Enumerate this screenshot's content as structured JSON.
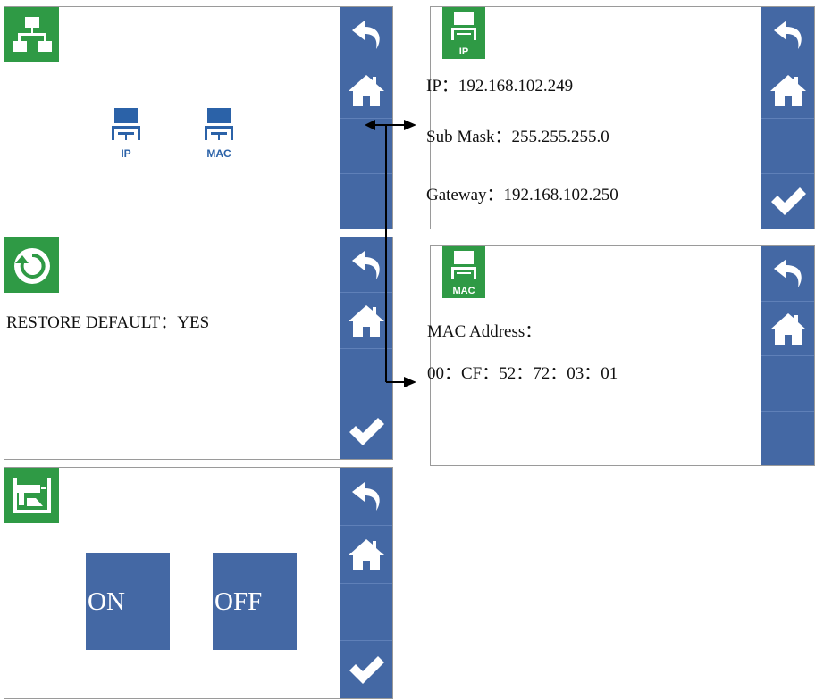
{
  "network_panel": {
    "buttons": [
      {
        "label": "IP"
      },
      {
        "label": "MAC"
      }
    ]
  },
  "restore_panel": {
    "text": "RESTORE DEFAULT：YES"
  },
  "switch_panel": {
    "on_label": "ON",
    "off_label": "OFF"
  },
  "ip_panel": {
    "badge_label": "IP",
    "ip": "IP：192.168.102.249",
    "mask": "Sub Mask：255.255.255.0",
    "gateway": "Gateway：192.168.102.250"
  },
  "mac_panel": {
    "badge_label": "MAC",
    "label": "MAC Address：",
    "value": "00：CF：52：72：03：01"
  },
  "colors": {
    "sidebar": "#4468a4",
    "badge": "#2f9a45",
    "network_icon": "#2b62a8"
  },
  "icons": [
    "network-icon",
    "restore-icon",
    "sewing-machine-icon",
    "back-icon",
    "home-icon",
    "check-icon",
    "computer-icon"
  ]
}
